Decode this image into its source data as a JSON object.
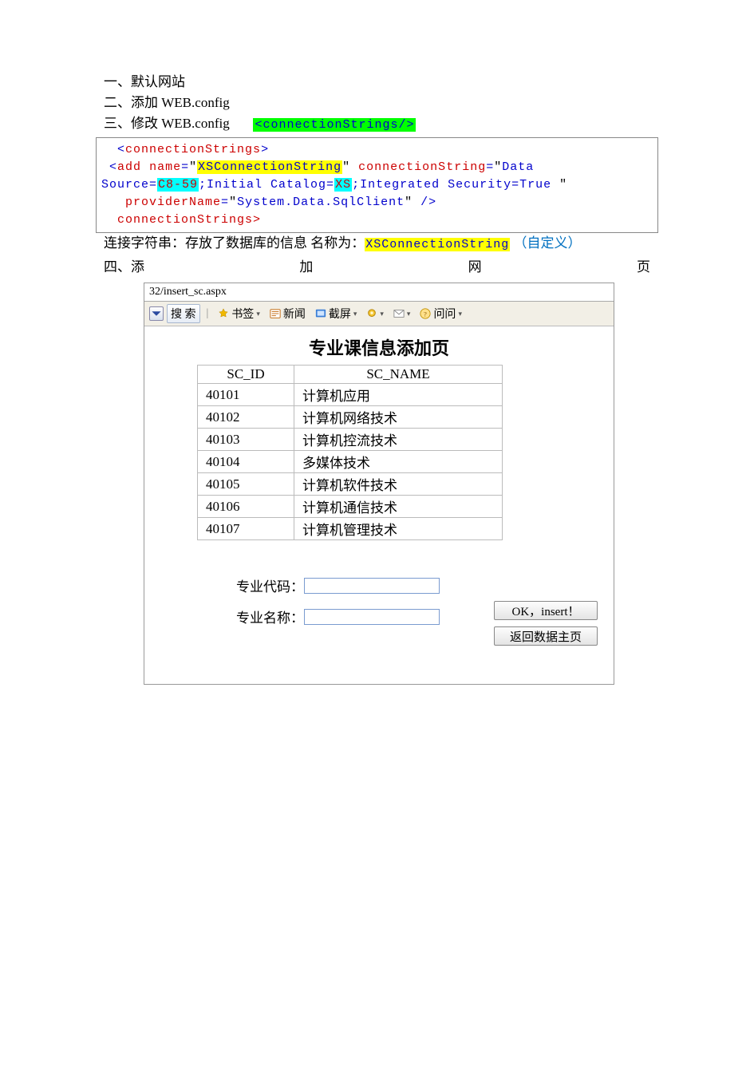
{
  "outline": {
    "item1": "一、默认网站",
    "item2": "二、添加 WEB.config",
    "item3_prefix": "三、修改 WEB.config",
    "item3_highlight": "<connectionStrings/>",
    "item4": {
      "c1": "四、添",
      "c2": "加",
      "c3": "网",
      "c4": "页"
    }
  },
  "code": {
    "open_tag_lt": "<",
    "open_tag_name": "connectionStrings",
    "open_tag_gt": ">",
    "add_lt": "<",
    "add_name": "add",
    "attr_name": "name",
    "eq": "=",
    "q": "\"",
    "name_val": "XSConnectionString",
    "attr_conn": "connectionString",
    "conn_prefix": "Data",
    "conn_source_label": "Source=",
    "conn_source_val": "C8-59",
    "conn_mid1": ";Initial Catalog=",
    "conn_catalog_val": "XS",
    "conn_mid2": ";Integrated Security=True ",
    "attr_provider": "providerName",
    "provider_val": "System.Data.SqlClient",
    "selfclose": " />",
    "close_tag": "connectionStrings>"
  },
  "note": {
    "prefix": "连接字符串：存放了数据库的信息   名称为：",
    "highlight": "XSConnectionString",
    "suffix": "  （自定义）"
  },
  "browser": {
    "url": "32/insert_sc.aspx",
    "search_btn": "搜 索",
    "bookmark": "书签",
    "news": "新闻",
    "screenshot": "截屏",
    "ask": "问问",
    "caret": "▾"
  },
  "webpage": {
    "title": "专业课信息添加页",
    "th_id": "SC_ID",
    "th_name": "SC_NAME",
    "rows": [
      {
        "id": "40101",
        "name": "计算机应用"
      },
      {
        "id": "40102",
        "name": "计算机网络技术"
      },
      {
        "id": "40103",
        "name": "计算机控流技术"
      },
      {
        "id": "40104",
        "name": "多媒体技术"
      },
      {
        "id": "40105",
        "name": "计算机软件技术"
      },
      {
        "id": "40106",
        "name": "计算机通信技术"
      },
      {
        "id": "40107",
        "name": "计算机管理技术"
      }
    ],
    "label_code": "专业代码：",
    "label_name": "专业名称：",
    "btn_ok": "OK，insert！",
    "btn_back": "返回数据主页"
  }
}
